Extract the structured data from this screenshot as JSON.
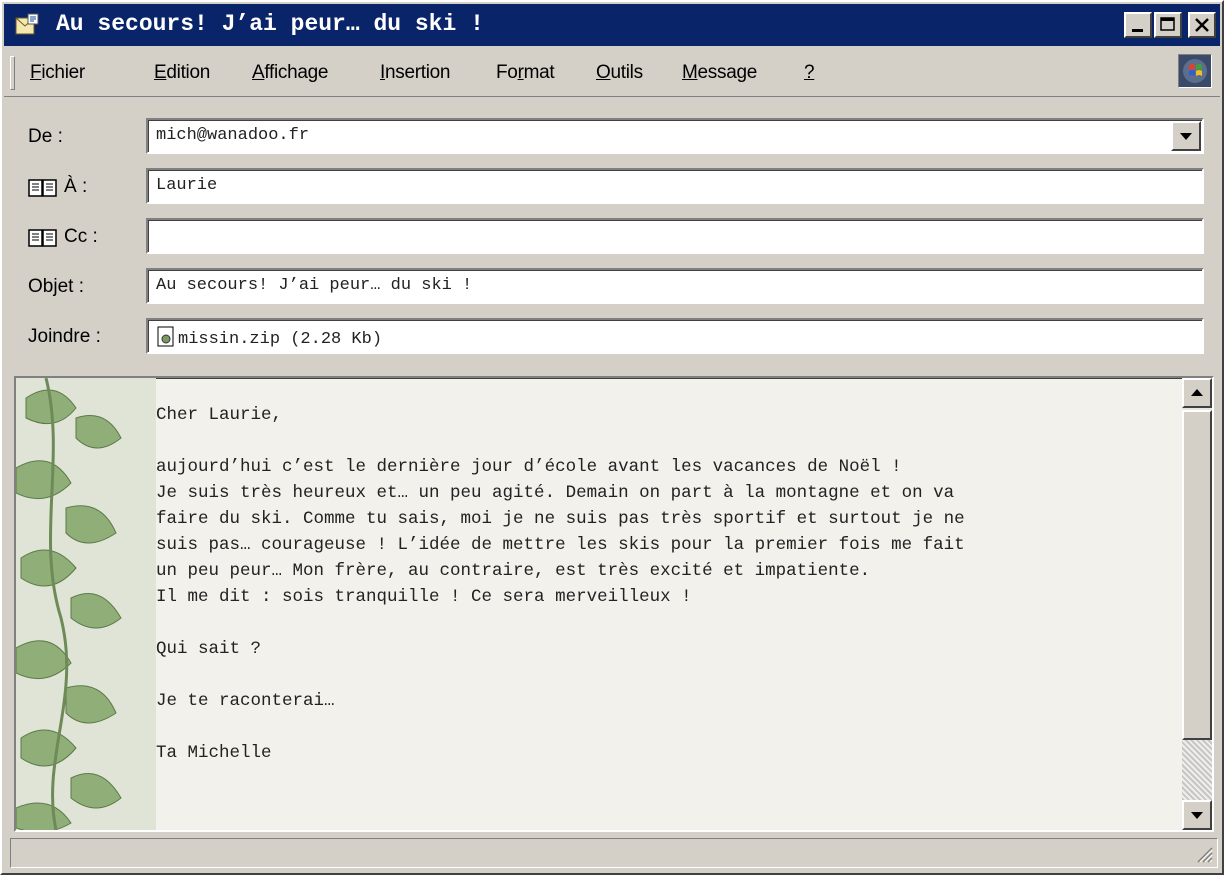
{
  "window": {
    "title": "Au secours! J’ai peur… du ski !",
    "buttons": [
      "minimize",
      "maximize",
      "close"
    ]
  },
  "menu": {
    "items": [
      {
        "label": "Fichier",
        "access_key": "F"
      },
      {
        "label": "Edition",
        "access_key": "E"
      },
      {
        "label": "Affichage",
        "access_key": "A"
      },
      {
        "label": "Insertion",
        "access_key": "I"
      },
      {
        "label": "Format",
        "access_key": "r"
      },
      {
        "label": "Outils",
        "access_key": "O"
      },
      {
        "label": "Message",
        "access_key": "M"
      },
      {
        "label": "?",
        "access_key": "?"
      }
    ]
  },
  "header": {
    "from": {
      "label": "De :",
      "value": "mich@wanadoo.fr"
    },
    "to": {
      "label": "À :",
      "value": "Laurie"
    },
    "cc": {
      "label": "Cc :",
      "value": ""
    },
    "subject": {
      "label": "Objet :",
      "value": "Au secours! J’ai peur… du ski !"
    },
    "attach": {
      "label": "Joindre :",
      "value": "missin.zip (2.28 Kb)"
    }
  },
  "message": {
    "body": "Cher Laurie,\n\naujourd’hui c’est le dernière jour d’école avant les vacances de Noël !\nJe suis très heureux et… un peu agité. Demain on part à la montagne et on va\nfaire du ski. Comme tu sais, moi je ne suis pas très sportif et surtout je ne\nsuis pas… courageuse ! L’idée de mettre les skis pour la premier fois me fait\nun peu peur… Mon frère, au contraire, est très excité et impatiente.\nIl me dit : sois tranquille ! Ce sera merveilleux !\n\nQui sait ?\n\nJe te raconterai…\n\nTa Michelle"
  },
  "colors": {
    "titlebar": "#0a246a",
    "chrome": "#d4d0c8",
    "body_bg": "#f2f1ec",
    "ivy": "#8fae78"
  },
  "icons": [
    "envelope-icon",
    "address-book-icon",
    "attachment-icon",
    "windows-throbber-icon",
    "scroll-up-icon",
    "scroll-down-icon",
    "dropdown-arrow-icon",
    "ivy-decoration"
  ]
}
